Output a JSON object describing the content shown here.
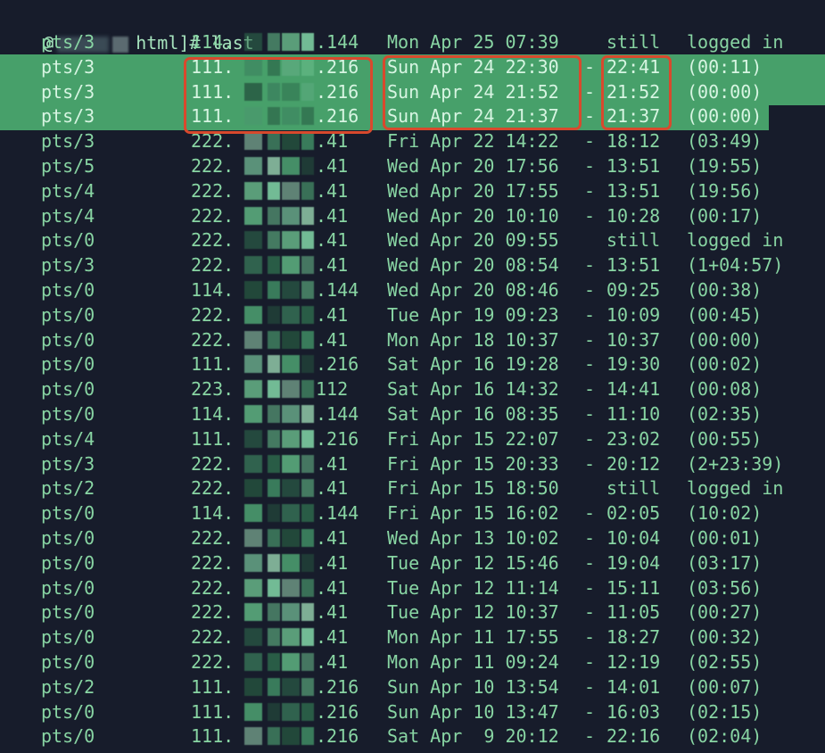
{
  "terminal": {
    "prompt_prefix": "@",
    "prompt_suffix": "html]# last",
    "rows": [
      {
        "tty": "pts/3",
        "ip_head": "114.",
        "ip_tail": ".144",
        "date": "Mon Apr 25 07:39",
        "dash": " ",
        "end": "still",
        "duration": "logged in"
      },
      {
        "tty": "pts/3",
        "ip_head": "111.",
        "ip_tail": ".216",
        "date": "Sun Apr 24 22:30",
        "dash": "-",
        "end": "22:41",
        "duration": "(00:11)"
      },
      {
        "tty": "pts/3",
        "ip_head": "111.",
        "ip_tail": ".216",
        "date": "Sun Apr 24 21:52",
        "dash": "-",
        "end": "21:52",
        "duration": "(00:00)"
      },
      {
        "tty": "pts/3",
        "ip_head": "111.",
        "ip_tail": ".216",
        "date": "Sun Apr 24 21:37",
        "dash": "-",
        "end": "21:37",
        "duration": "(00:00)"
      },
      {
        "tty": "pts/3",
        "ip_head": "222.",
        "ip_tail": ".41",
        "date": "Fri Apr 22 14:22",
        "dash": "-",
        "end": "18:12",
        "duration": "(03:49)"
      },
      {
        "tty": "pts/5",
        "ip_head": "222.",
        "ip_tail": ".41",
        "date": "Wed Apr 20 17:56",
        "dash": "-",
        "end": "13:51",
        "duration": "(19:55)"
      },
      {
        "tty": "pts/4",
        "ip_head": "222.",
        "ip_tail": ".41",
        "date": "Wed Apr 20 17:55",
        "dash": "-",
        "end": "13:51",
        "duration": "(19:56)"
      },
      {
        "tty": "pts/4",
        "ip_head": "222.",
        "ip_tail": ".41",
        "date": "Wed Apr 20 10:10",
        "dash": "-",
        "end": "10:28",
        "duration": "(00:17)"
      },
      {
        "tty": "pts/0",
        "ip_head": "222.",
        "ip_tail": ".41",
        "date": "Wed Apr 20 09:55",
        "dash": " ",
        "end": "still",
        "duration": "logged in"
      },
      {
        "tty": "pts/3",
        "ip_head": "222.",
        "ip_tail": ".41",
        "date": "Wed Apr 20 08:54",
        "dash": "-",
        "end": "13:51",
        "duration": "(1+04:57)"
      },
      {
        "tty": "pts/0",
        "ip_head": "114.",
        "ip_tail": ".144",
        "date": "Wed Apr 20 08:46",
        "dash": "-",
        "end": "09:25",
        "duration": "(00:38)"
      },
      {
        "tty": "pts/0",
        "ip_head": "222.",
        "ip_tail": ".41",
        "date": "Tue Apr 19 09:23",
        "dash": "-",
        "end": "10:09",
        "duration": "(00:45)"
      },
      {
        "tty": "pts/0",
        "ip_head": "222.",
        "ip_tail": ".41",
        "date": "Mon Apr 18 10:37",
        "dash": "-",
        "end": "10:37",
        "duration": "(00:00)"
      },
      {
        "tty": "pts/0",
        "ip_head": "111.",
        "ip_tail": ".216",
        "date": "Sat Apr 16 19:28",
        "dash": "-",
        "end": "19:30",
        "duration": "(00:02)"
      },
      {
        "tty": "pts/0",
        "ip_head": "223.",
        "ip_tail": "112",
        "date": "Sat Apr 16 14:32",
        "dash": "-",
        "end": "14:41",
        "duration": "(00:08)"
      },
      {
        "tty": "pts/0",
        "ip_head": "114.",
        "ip_tail": ".144",
        "date": "Sat Apr 16 08:35",
        "dash": "-",
        "end": "11:10",
        "duration": "(02:35)"
      },
      {
        "tty": "pts/4",
        "ip_head": "111.",
        "ip_tail": ".216",
        "date": "Fri Apr 15 22:07",
        "dash": "-",
        "end": "23:02",
        "duration": "(00:55)"
      },
      {
        "tty": "pts/3",
        "ip_head": "222.",
        "ip_tail": ".41",
        "date": "Fri Apr 15 20:33",
        "dash": "-",
        "end": "20:12",
        "duration": "(2+23:39)"
      },
      {
        "tty": "pts/2",
        "ip_head": "222.",
        "ip_tail": ".41",
        "date": "Fri Apr 15 18:50",
        "dash": " ",
        "end": "still",
        "duration": "logged in"
      },
      {
        "tty": "pts/0",
        "ip_head": "114.",
        "ip_tail": ".144",
        "date": "Fri Apr 15 16:02",
        "dash": "-",
        "end": "02:05",
        "duration": "(10:02)"
      },
      {
        "tty": "pts/0",
        "ip_head": "222.",
        "ip_tail": ".41",
        "date": "Wed Apr 13 10:02",
        "dash": "-",
        "end": "10:04",
        "duration": "(00:01)"
      },
      {
        "tty": "pts/0",
        "ip_head": "222.",
        "ip_tail": ".41",
        "date": "Tue Apr 12 15:46",
        "dash": "-",
        "end": "19:04",
        "duration": "(03:17)"
      },
      {
        "tty": "pts/0",
        "ip_head": "222.",
        "ip_tail": ".41",
        "date": "Tue Apr 12 11:14",
        "dash": "-",
        "end": "15:11",
        "duration": "(03:56)"
      },
      {
        "tty": "pts/0",
        "ip_head": "222.",
        "ip_tail": ".41",
        "date": "Tue Apr 12 10:37",
        "dash": "-",
        "end": "11:05",
        "duration": "(00:27)"
      },
      {
        "tty": "pts/0",
        "ip_head": "222.",
        "ip_tail": ".41",
        "date": "Mon Apr 11 17:55",
        "dash": "-",
        "end": "18:27",
        "duration": "(00:32)"
      },
      {
        "tty": "pts/0",
        "ip_head": "222.",
        "ip_tail": ".41",
        "date": "Mon Apr 11 09:24",
        "dash": "-",
        "end": "12:19",
        "duration": "(02:55)"
      },
      {
        "tty": "pts/2",
        "ip_head": "111.",
        "ip_tail": ".216",
        "date": "Sun Apr 10 13:54",
        "dash": "-",
        "end": "14:01",
        "duration": "(00:07)"
      },
      {
        "tty": "pts/0",
        "ip_head": "111.",
        "ip_tail": ".216",
        "date": "Sun Apr 10 13:47",
        "dash": "-",
        "end": "16:03",
        "duration": "(02:15)"
      },
      {
        "tty": "pts/0",
        "ip_head": "111.",
        "ip_tail": ".216",
        "date": "Sat Apr  9 20:12",
        "dash": "-",
        "end": "22:16",
        "duration": "(02:04)"
      }
    ]
  },
  "colors": {
    "background": "#171c2b",
    "text": "#88d5a3",
    "selection": "#47a06a",
    "annotation_box": "#d8492d"
  }
}
